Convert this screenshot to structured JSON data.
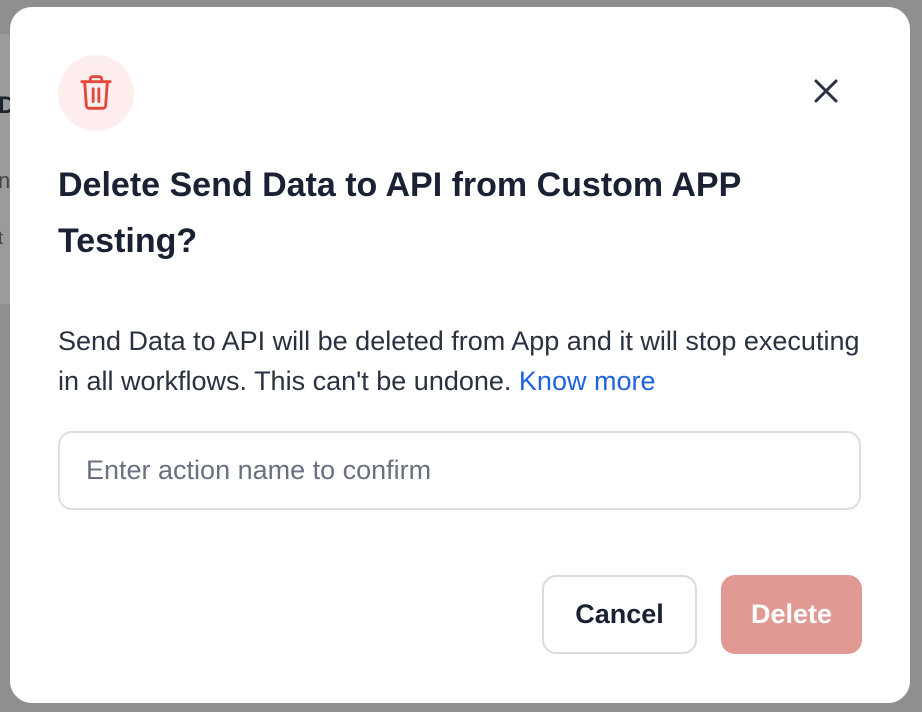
{
  "background": {
    "glyphs": [
      "D",
      "n",
      "t"
    ]
  },
  "modal": {
    "icon": "trash-icon",
    "icon_color": "#e0493b",
    "title": "Delete Send Data to API from Custom APP Testing?",
    "description": "Send Data to API will be deleted from App and it will stop executing in all workflows. This can't be undone.",
    "know_more_label": "Know more",
    "confirm_input": {
      "value": "",
      "placeholder": "Enter action name to confirm"
    },
    "cancel_label": "Cancel",
    "delete_label": "Delete",
    "delete_color": "#e09a93",
    "link_color": "#1f63e0"
  }
}
